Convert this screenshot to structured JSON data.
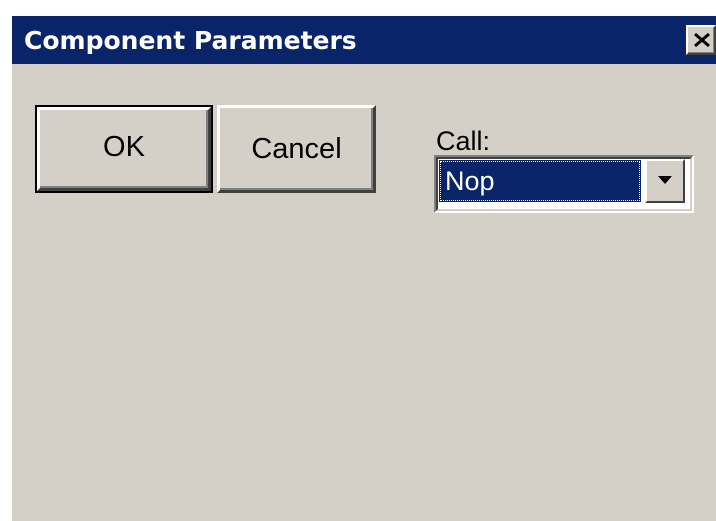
{
  "window": {
    "title": "Component Parameters"
  },
  "buttons": {
    "ok_label": "OK",
    "cancel_label": "Cancel"
  },
  "call": {
    "label": "Call:",
    "selected_value": "Nop"
  },
  "icons": {
    "close": "close-icon",
    "dropdown_arrow": "chevron-down-icon"
  },
  "colors": {
    "title_bar": "#0a246a",
    "dialog_background": "#d4d0c8",
    "selection": "#0a246a"
  }
}
